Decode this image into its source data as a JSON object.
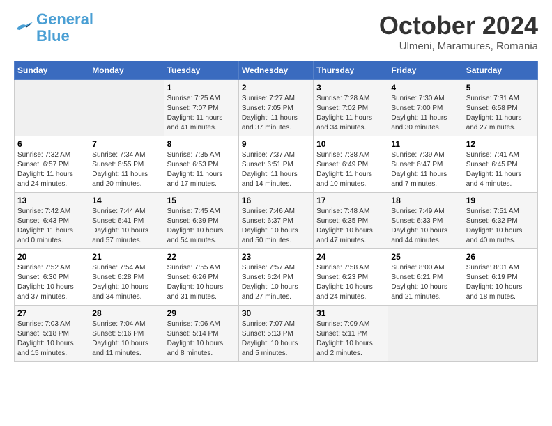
{
  "header": {
    "logo_general": "General",
    "logo_blue": "Blue",
    "month": "October 2024",
    "location": "Ulmeni, Maramures, Romania"
  },
  "weekdays": [
    "Sunday",
    "Monday",
    "Tuesday",
    "Wednesday",
    "Thursday",
    "Friday",
    "Saturday"
  ],
  "weeks": [
    [
      {
        "day": "",
        "sunrise": "",
        "sunset": "",
        "daylight": ""
      },
      {
        "day": "",
        "sunrise": "",
        "sunset": "",
        "daylight": ""
      },
      {
        "day": "1",
        "sunrise": "Sunrise: 7:25 AM",
        "sunset": "Sunset: 7:07 PM",
        "daylight": "Daylight: 11 hours and 41 minutes."
      },
      {
        "day": "2",
        "sunrise": "Sunrise: 7:27 AM",
        "sunset": "Sunset: 7:05 PM",
        "daylight": "Daylight: 11 hours and 37 minutes."
      },
      {
        "day": "3",
        "sunrise": "Sunrise: 7:28 AM",
        "sunset": "Sunset: 7:02 PM",
        "daylight": "Daylight: 11 hours and 34 minutes."
      },
      {
        "day": "4",
        "sunrise": "Sunrise: 7:30 AM",
        "sunset": "Sunset: 7:00 PM",
        "daylight": "Daylight: 11 hours and 30 minutes."
      },
      {
        "day": "5",
        "sunrise": "Sunrise: 7:31 AM",
        "sunset": "Sunset: 6:58 PM",
        "daylight": "Daylight: 11 hours and 27 minutes."
      }
    ],
    [
      {
        "day": "6",
        "sunrise": "Sunrise: 7:32 AM",
        "sunset": "Sunset: 6:57 PM",
        "daylight": "Daylight: 11 hours and 24 minutes."
      },
      {
        "day": "7",
        "sunrise": "Sunrise: 7:34 AM",
        "sunset": "Sunset: 6:55 PM",
        "daylight": "Daylight: 11 hours and 20 minutes."
      },
      {
        "day": "8",
        "sunrise": "Sunrise: 7:35 AM",
        "sunset": "Sunset: 6:53 PM",
        "daylight": "Daylight: 11 hours and 17 minutes."
      },
      {
        "day": "9",
        "sunrise": "Sunrise: 7:37 AM",
        "sunset": "Sunset: 6:51 PM",
        "daylight": "Daylight: 11 hours and 14 minutes."
      },
      {
        "day": "10",
        "sunrise": "Sunrise: 7:38 AM",
        "sunset": "Sunset: 6:49 PM",
        "daylight": "Daylight: 11 hours and 10 minutes."
      },
      {
        "day": "11",
        "sunrise": "Sunrise: 7:39 AM",
        "sunset": "Sunset: 6:47 PM",
        "daylight": "Daylight: 11 hours and 7 minutes."
      },
      {
        "day": "12",
        "sunrise": "Sunrise: 7:41 AM",
        "sunset": "Sunset: 6:45 PM",
        "daylight": "Daylight: 11 hours and 4 minutes."
      }
    ],
    [
      {
        "day": "13",
        "sunrise": "Sunrise: 7:42 AM",
        "sunset": "Sunset: 6:43 PM",
        "daylight": "Daylight: 11 hours and 0 minutes."
      },
      {
        "day": "14",
        "sunrise": "Sunrise: 7:44 AM",
        "sunset": "Sunset: 6:41 PM",
        "daylight": "Daylight: 10 hours and 57 minutes."
      },
      {
        "day": "15",
        "sunrise": "Sunrise: 7:45 AM",
        "sunset": "Sunset: 6:39 PM",
        "daylight": "Daylight: 10 hours and 54 minutes."
      },
      {
        "day": "16",
        "sunrise": "Sunrise: 7:46 AM",
        "sunset": "Sunset: 6:37 PM",
        "daylight": "Daylight: 10 hours and 50 minutes."
      },
      {
        "day": "17",
        "sunrise": "Sunrise: 7:48 AM",
        "sunset": "Sunset: 6:35 PM",
        "daylight": "Daylight: 10 hours and 47 minutes."
      },
      {
        "day": "18",
        "sunrise": "Sunrise: 7:49 AM",
        "sunset": "Sunset: 6:33 PM",
        "daylight": "Daylight: 10 hours and 44 minutes."
      },
      {
        "day": "19",
        "sunrise": "Sunrise: 7:51 AM",
        "sunset": "Sunset: 6:32 PM",
        "daylight": "Daylight: 10 hours and 40 minutes."
      }
    ],
    [
      {
        "day": "20",
        "sunrise": "Sunrise: 7:52 AM",
        "sunset": "Sunset: 6:30 PM",
        "daylight": "Daylight: 10 hours and 37 minutes."
      },
      {
        "day": "21",
        "sunrise": "Sunrise: 7:54 AM",
        "sunset": "Sunset: 6:28 PM",
        "daylight": "Daylight: 10 hours and 34 minutes."
      },
      {
        "day": "22",
        "sunrise": "Sunrise: 7:55 AM",
        "sunset": "Sunset: 6:26 PM",
        "daylight": "Daylight: 10 hours and 31 minutes."
      },
      {
        "day": "23",
        "sunrise": "Sunrise: 7:57 AM",
        "sunset": "Sunset: 6:24 PM",
        "daylight": "Daylight: 10 hours and 27 minutes."
      },
      {
        "day": "24",
        "sunrise": "Sunrise: 7:58 AM",
        "sunset": "Sunset: 6:23 PM",
        "daylight": "Daylight: 10 hours and 24 minutes."
      },
      {
        "day": "25",
        "sunrise": "Sunrise: 8:00 AM",
        "sunset": "Sunset: 6:21 PM",
        "daylight": "Daylight: 10 hours and 21 minutes."
      },
      {
        "day": "26",
        "sunrise": "Sunrise: 8:01 AM",
        "sunset": "Sunset: 6:19 PM",
        "daylight": "Daylight: 10 hours and 18 minutes."
      }
    ],
    [
      {
        "day": "27",
        "sunrise": "Sunrise: 7:03 AM",
        "sunset": "Sunset: 5:18 PM",
        "daylight": "Daylight: 10 hours and 15 minutes."
      },
      {
        "day": "28",
        "sunrise": "Sunrise: 7:04 AM",
        "sunset": "Sunset: 5:16 PM",
        "daylight": "Daylight: 10 hours and 11 minutes."
      },
      {
        "day": "29",
        "sunrise": "Sunrise: 7:06 AM",
        "sunset": "Sunset: 5:14 PM",
        "daylight": "Daylight: 10 hours and 8 minutes."
      },
      {
        "day": "30",
        "sunrise": "Sunrise: 7:07 AM",
        "sunset": "Sunset: 5:13 PM",
        "daylight": "Daylight: 10 hours and 5 minutes."
      },
      {
        "day": "31",
        "sunrise": "Sunrise: 7:09 AM",
        "sunset": "Sunset: 5:11 PM",
        "daylight": "Daylight: 10 hours and 2 minutes."
      },
      {
        "day": "",
        "sunrise": "",
        "sunset": "",
        "daylight": ""
      },
      {
        "day": "",
        "sunrise": "",
        "sunset": "",
        "daylight": ""
      }
    ]
  ]
}
